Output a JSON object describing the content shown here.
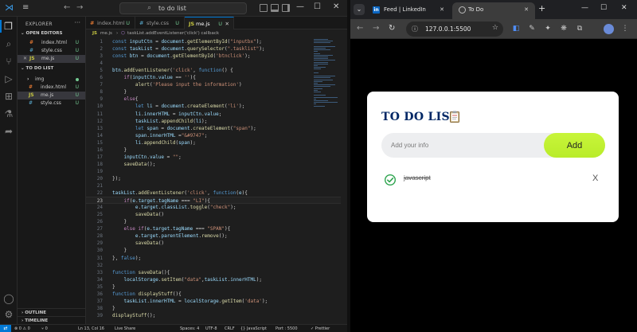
{
  "vscode": {
    "titlebar": {
      "command_center": "to do list",
      "back_arrow": "←",
      "forward_arrow": "→",
      "window_controls": {
        "minimize": "—",
        "maximize": "☐",
        "close": "✕"
      }
    },
    "sidebar": {
      "title": "EXPLORER",
      "more": "···",
      "open_editors_label": "OPEN EDITORS",
      "open_editors": [
        {
          "icon": "#",
          "name": "index.html",
          "status": "U",
          "close": "",
          "icon_color": "#e37933"
        },
        {
          "icon": "#",
          "name": "style.css",
          "status": "U",
          "close": "",
          "icon_color": "#519aba"
        },
        {
          "icon": "JS",
          "name": "me.js",
          "status": "U",
          "close": "✕",
          "icon_color": "#cbcb41"
        }
      ],
      "project_label": "TO DO LIST",
      "files": [
        {
          "icon": "›",
          "name": "img",
          "status": "",
          "is_folder": true,
          "icon_color": "#cccccc"
        },
        {
          "icon": "#",
          "name": "index.html",
          "status": "U",
          "icon_color": "#e37933"
        },
        {
          "icon": "JS",
          "name": "me.js",
          "status": "U",
          "icon_color": "#cbcb41"
        },
        {
          "icon": "#",
          "name": "style.css",
          "status": "U",
          "icon_color": "#519aba"
        }
      ],
      "outline_label": "OUTLINE",
      "timeline_label": "TIMELINE"
    },
    "tabs": [
      {
        "icon": "#",
        "name": "index.html",
        "state": "U",
        "active": false,
        "icon_color": "#e37933"
      },
      {
        "icon": "#",
        "name": "style.css",
        "state": "U",
        "active": false,
        "icon_color": "#519aba"
      },
      {
        "icon": "JS",
        "name": "me.js",
        "state": "U",
        "active": true,
        "icon_color": "#cbcb41"
      }
    ],
    "breadcrumb": {
      "file": "me.js",
      "separator": "›",
      "symbol": "taskList.addEventListener('click') callback"
    },
    "code_lines": [
      {
        "n": "1",
        "tokens": [
          [
            "kw",
            "const "
          ],
          [
            "vr",
            "inputCtn"
          ],
          [
            "pl",
            " = "
          ],
          [
            "vr",
            "document"
          ],
          [
            "pl",
            "."
          ],
          [
            "fn",
            "getElementById"
          ],
          [
            "pl",
            "("
          ],
          [
            "st",
            "\"inputbx\""
          ],
          [
            "pl",
            ");"
          ]
        ]
      },
      {
        "n": "2",
        "tokens": [
          [
            "kw",
            "const "
          ],
          [
            "vr",
            "taskList"
          ],
          [
            "pl",
            " = "
          ],
          [
            "vr",
            "document"
          ],
          [
            "pl",
            "."
          ],
          [
            "fn",
            "querySelector"
          ],
          [
            "pl",
            "("
          ],
          [
            "st",
            "\".tasklist\""
          ],
          [
            "pl",
            ");"
          ]
        ]
      },
      {
        "n": "3",
        "tokens": [
          [
            "kw",
            "const "
          ],
          [
            "vr",
            "btn"
          ],
          [
            "pl",
            " = "
          ],
          [
            "vr",
            "document"
          ],
          [
            "pl",
            "."
          ],
          [
            "fn",
            "getElementById"
          ],
          [
            "pl",
            "("
          ],
          [
            "st",
            "'btnclick'"
          ],
          [
            "pl",
            ");"
          ]
        ]
      },
      {
        "n": "4",
        "tokens": []
      },
      {
        "n": "5",
        "tokens": [
          [
            "vr",
            "btn"
          ],
          [
            "pl",
            "."
          ],
          [
            "fn",
            "addEventListener"
          ],
          [
            "pl",
            "("
          ],
          [
            "st",
            "'click'"
          ],
          [
            "pl",
            ", "
          ],
          [
            "kw",
            "function"
          ],
          [
            "pl",
            "() {"
          ]
        ]
      },
      {
        "n": "6",
        "tokens": [
          [
            "pl",
            "    "
          ],
          [
            "ct",
            "if"
          ],
          [
            "pl",
            "("
          ],
          [
            "vr",
            "inputCtn"
          ],
          [
            "pl",
            "."
          ],
          [
            "vr",
            "value"
          ],
          [
            "pl",
            " == "
          ],
          [
            "st",
            "''"
          ],
          [
            "pl",
            "){"
          ]
        ]
      },
      {
        "n": "7",
        "tokens": [
          [
            "pl",
            "        "
          ],
          [
            "fn",
            "alert"
          ],
          [
            "pl",
            "("
          ],
          [
            "st",
            "'Please input the information'"
          ],
          [
            "pl",
            ")"
          ]
        ]
      },
      {
        "n": "8",
        "tokens": [
          [
            "pl",
            "    }"
          ]
        ]
      },
      {
        "n": "9",
        "tokens": [
          [
            "pl",
            "    "
          ],
          [
            "ct",
            "else"
          ],
          [
            "pl",
            "{"
          ]
        ]
      },
      {
        "n": "10",
        "tokens": [
          [
            "pl",
            "        "
          ],
          [
            "kw",
            "let "
          ],
          [
            "vr",
            "li"
          ],
          [
            "pl",
            " = "
          ],
          [
            "vr",
            "document"
          ],
          [
            "pl",
            "."
          ],
          [
            "fn",
            "createElement"
          ],
          [
            "pl",
            "("
          ],
          [
            "st",
            "'li'"
          ],
          [
            "pl",
            ");"
          ]
        ]
      },
      {
        "n": "11",
        "tokens": [
          [
            "pl",
            "        "
          ],
          [
            "vr",
            "li"
          ],
          [
            "pl",
            "."
          ],
          [
            "vr",
            "innerHTML"
          ],
          [
            "pl",
            " = "
          ],
          [
            "vr",
            "inputCtn"
          ],
          [
            "pl",
            "."
          ],
          [
            "vr",
            "value"
          ],
          [
            "pl",
            ";"
          ]
        ]
      },
      {
        "n": "12",
        "tokens": [
          [
            "pl",
            "        "
          ],
          [
            "vr",
            "taskList"
          ],
          [
            "pl",
            "."
          ],
          [
            "fn",
            "appendChild"
          ],
          [
            "pl",
            "("
          ],
          [
            "vr",
            "li"
          ],
          [
            "pl",
            ");"
          ]
        ]
      },
      {
        "n": "13",
        "tokens": [
          [
            "pl",
            "        "
          ],
          [
            "kw",
            "let "
          ],
          [
            "vr",
            "span"
          ],
          [
            "pl",
            " = "
          ],
          [
            "vr",
            "document"
          ],
          [
            "pl",
            "."
          ],
          [
            "fn",
            "createElement"
          ],
          [
            "pl",
            "("
          ],
          [
            "st",
            "\"span\""
          ],
          [
            "pl",
            ");"
          ]
        ]
      },
      {
        "n": "14",
        "tokens": [
          [
            "pl",
            "        "
          ],
          [
            "vr",
            "span"
          ],
          [
            "pl",
            "."
          ],
          [
            "vr",
            "innerHTML"
          ],
          [
            "pl",
            " ="
          ],
          [
            "st",
            "\"&#9747\""
          ],
          [
            "pl",
            ";"
          ]
        ]
      },
      {
        "n": "15",
        "tokens": [
          [
            "pl",
            "        "
          ],
          [
            "vr",
            "li"
          ],
          [
            "pl",
            "."
          ],
          [
            "fn",
            "appendChild"
          ],
          [
            "pl",
            "("
          ],
          [
            "vr",
            "span"
          ],
          [
            "pl",
            ");"
          ]
        ]
      },
      {
        "n": "16",
        "tokens": [
          [
            "pl",
            "    }"
          ]
        ]
      },
      {
        "n": "17",
        "tokens": [
          [
            "pl",
            "    "
          ],
          [
            "vr",
            "inputCtn"
          ],
          [
            "pl",
            "."
          ],
          [
            "vr",
            "value"
          ],
          [
            "pl",
            " = "
          ],
          [
            "st",
            "\"\""
          ],
          [
            "pl",
            ";"
          ]
        ]
      },
      {
        "n": "18",
        "tokens": [
          [
            "pl",
            "    "
          ],
          [
            "fn",
            "saveData"
          ],
          [
            "pl",
            "();"
          ]
        ]
      },
      {
        "n": "19",
        "tokens": []
      },
      {
        "n": "20",
        "tokens": [
          [
            "pl",
            "});"
          ]
        ]
      },
      {
        "n": "21",
        "tokens": []
      },
      {
        "n": "22",
        "tokens": [
          [
            "vr",
            "taskList"
          ],
          [
            "pl",
            "."
          ],
          [
            "fn",
            "addEventListener"
          ],
          [
            "pl",
            "("
          ],
          [
            "st",
            "'click'"
          ],
          [
            "pl",
            ", "
          ],
          [
            "kw",
            "function"
          ],
          [
            "pl",
            "("
          ],
          [
            "vr",
            "e"
          ],
          [
            "pl",
            "){"
          ]
        ]
      },
      {
        "n": "23",
        "tokens": [
          [
            "pl",
            "    "
          ],
          [
            "ct",
            "if"
          ],
          [
            "pl",
            "("
          ],
          [
            "vr",
            "e"
          ],
          [
            "pl",
            "."
          ],
          [
            "vr",
            "target"
          ],
          [
            "pl",
            "."
          ],
          [
            "vr",
            "tagName"
          ],
          [
            "pl",
            " === "
          ],
          [
            "st",
            "\"LI\""
          ],
          [
            "pl",
            "){"
          ]
        ],
        "current": true
      },
      {
        "n": "24",
        "tokens": [
          [
            "pl",
            "        "
          ],
          [
            "vr",
            "e"
          ],
          [
            "pl",
            "."
          ],
          [
            "vr",
            "target"
          ],
          [
            "pl",
            "."
          ],
          [
            "vr",
            "classList"
          ],
          [
            "pl",
            "."
          ],
          [
            "fn",
            "toggle"
          ],
          [
            "pl",
            "("
          ],
          [
            "st",
            "\"check\""
          ],
          [
            "pl",
            ");"
          ]
        ]
      },
      {
        "n": "25",
        "tokens": [
          [
            "pl",
            "        "
          ],
          [
            "fn",
            "saveData"
          ],
          [
            "pl",
            "()"
          ]
        ]
      },
      {
        "n": "26",
        "tokens": [
          [
            "pl",
            "    }"
          ]
        ]
      },
      {
        "n": "27",
        "tokens": [
          [
            "pl",
            "    "
          ],
          [
            "ct",
            "else if"
          ],
          [
            "pl",
            "("
          ],
          [
            "vr",
            "e"
          ],
          [
            "pl",
            "."
          ],
          [
            "vr",
            "target"
          ],
          [
            "pl",
            "."
          ],
          [
            "vr",
            "tagName"
          ],
          [
            "pl",
            " === "
          ],
          [
            "st",
            "\"SPAN\""
          ],
          [
            "pl",
            "){"
          ]
        ]
      },
      {
        "n": "28",
        "tokens": [
          [
            "pl",
            "        "
          ],
          [
            "vr",
            "e"
          ],
          [
            "pl",
            "."
          ],
          [
            "vr",
            "target"
          ],
          [
            "pl",
            "."
          ],
          [
            "vr",
            "parentElement"
          ],
          [
            "pl",
            "."
          ],
          [
            "fn",
            "remove"
          ],
          [
            "pl",
            "();"
          ]
        ]
      },
      {
        "n": "29",
        "tokens": [
          [
            "pl",
            "        "
          ],
          [
            "fn",
            "saveData"
          ],
          [
            "pl",
            "()"
          ]
        ]
      },
      {
        "n": "30",
        "tokens": [
          [
            "pl",
            "    }"
          ]
        ]
      },
      {
        "n": "31",
        "tokens": [
          [
            "pl",
            "}, "
          ],
          [
            "kw",
            "false"
          ],
          [
            "pl",
            ");"
          ]
        ]
      },
      {
        "n": "32",
        "tokens": []
      },
      {
        "n": "33",
        "tokens": [
          [
            "kw",
            "function "
          ],
          [
            "fn",
            "saveData"
          ],
          [
            "pl",
            "(){"
          ]
        ]
      },
      {
        "n": "34",
        "tokens": [
          [
            "pl",
            "    "
          ],
          [
            "vr",
            "localStorage"
          ],
          [
            "pl",
            "."
          ],
          [
            "fn",
            "setItem"
          ],
          [
            "pl",
            "("
          ],
          [
            "st",
            "\"data\""
          ],
          [
            "pl",
            ","
          ],
          [
            "vr",
            "taskList"
          ],
          [
            "pl",
            "."
          ],
          [
            "vr",
            "innerHTML"
          ],
          [
            "pl",
            ");"
          ]
        ]
      },
      {
        "n": "35",
        "tokens": [
          [
            "pl",
            "}"
          ]
        ]
      },
      {
        "n": "36",
        "tokens": [
          [
            "kw",
            "function "
          ],
          [
            "fn",
            "displayStuff"
          ],
          [
            "pl",
            "(){"
          ]
        ]
      },
      {
        "n": "37",
        "tokens": [
          [
            "pl",
            "    "
          ],
          [
            "vr",
            "taskList"
          ],
          [
            "pl",
            "."
          ],
          [
            "vr",
            "innerHTML"
          ],
          [
            "pl",
            " = "
          ],
          [
            "vr",
            "localStorage"
          ],
          [
            "pl",
            "."
          ],
          [
            "fn",
            "getItem"
          ],
          [
            "pl",
            "("
          ],
          [
            "st",
            "'data'"
          ],
          [
            "pl",
            ");"
          ]
        ]
      },
      {
        "n": "38",
        "tokens": [
          [
            "pl",
            "}"
          ]
        ]
      },
      {
        "n": "39",
        "tokens": [
          [
            "fn",
            "displayStuff"
          ],
          [
            "pl",
            "();"
          ]
        ]
      }
    ],
    "statusbar": {
      "remote": "⇄",
      "errors": "⊗ 0 ⚠ 0",
      "ports": "⑂ 0",
      "position": "Ln 13, Col 16",
      "live_share": "Live Share",
      "spaces": "Spaces: 4",
      "encoding": "UTF-8",
      "eol": "CRLF",
      "language": "{} JavaScript",
      "port": "Port : 5500",
      "prettier": "✓ Prettier"
    }
  },
  "browser": {
    "tab_search": "⌄",
    "tabs": [
      {
        "title": "Feed | LinkedIn",
        "close": "✕",
        "active": false,
        "badge": "in"
      },
      {
        "title": "To Do",
        "close": "✕",
        "active": true
      }
    ],
    "new_tab": "+",
    "window_controls": {
      "minimize": "—",
      "maximize": "☐",
      "close": "✕"
    },
    "nav": {
      "back": "←",
      "forward": "→",
      "reload": "↻"
    },
    "omnibox": {
      "site_icon": "ⓘ",
      "url": "127.0.0.1:5500",
      "bookmark": "☆"
    },
    "extensions": [
      "◧",
      "✎",
      "✦",
      "❋",
      "⧉",
      "⋮"
    ],
    "page": {
      "title": "TO DO LIST",
      "input_placeholder": "Add your info",
      "input_value": "",
      "add_button": "Add",
      "tasks": [
        {
          "text": "javascript",
          "checked": true,
          "delete_label": "X"
        }
      ],
      "colors": {
        "title": "#002765",
        "add_button": "#c8f53a",
        "check": "#2ea44f",
        "background": "#000000"
      }
    }
  }
}
